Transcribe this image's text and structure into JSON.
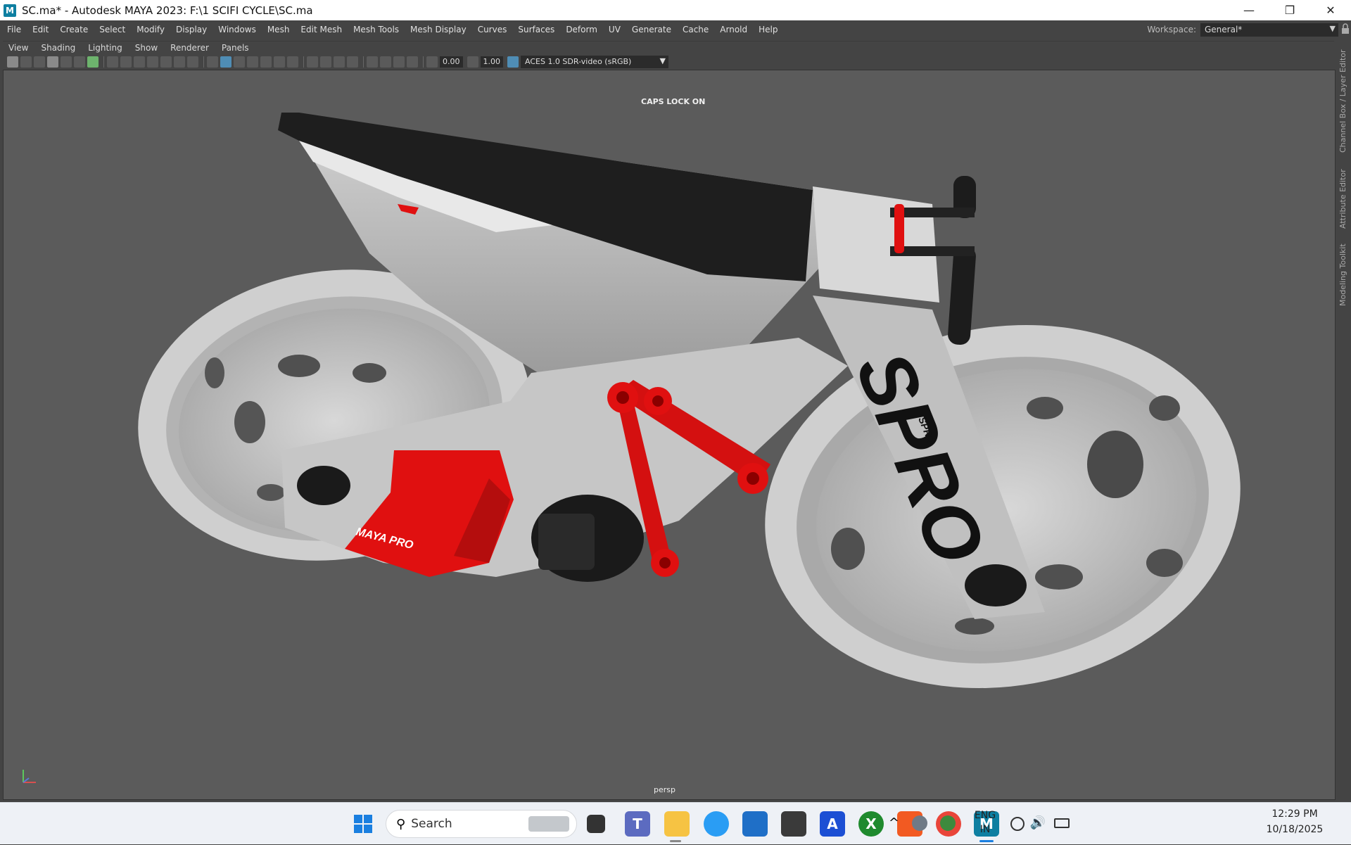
{
  "window": {
    "title": "SC.ma* - Autodesk MAYA 2023: F:\\1 SCIFI CYCLE\\SC.ma",
    "app_icon": "M",
    "minimize_icon": "—",
    "restore_icon": "❐",
    "close_icon": "✕"
  },
  "menubar": {
    "items": [
      "File",
      "Edit",
      "Create",
      "Select",
      "Modify",
      "Display",
      "Windows",
      "Mesh",
      "Edit Mesh",
      "Mesh Tools",
      "Mesh Display",
      "Curves",
      "Surfaces",
      "Deform",
      "UV",
      "Generate",
      "Cache",
      "Arnold",
      "Help"
    ]
  },
  "workspace": {
    "label": "Workspace:",
    "value": "General*"
  },
  "panel_menu": {
    "items": [
      "View",
      "Shading",
      "Lighting",
      "Show",
      "Renderer",
      "Panels"
    ]
  },
  "toolbar": {
    "field_a": "0.00",
    "field_b": "1.00",
    "color_space": "ACES 1.0 SDR-video (sRGB)"
  },
  "viewport": {
    "caps_lock": "CAPS LOCK ON",
    "camera": "persp",
    "decals": {
      "fork": "SPRO",
      "fork_small": "SPRO",
      "battery": "MAYA PRO"
    },
    "colors": {
      "background": "#5b5b5b",
      "frame": "#c4c4c4",
      "accent": "#e01010",
      "seat": "#1e1e1e"
    }
  },
  "sidebar": {
    "labels": [
      "Channel Box / Layer Editor",
      "Attribute Editor",
      "Modeling Toolkit"
    ]
  },
  "taskbar": {
    "search_placeholder": "Search",
    "apps": [
      "windows-start",
      "search",
      "task-view",
      "teams",
      "file-explorer",
      "edge",
      "store",
      "unity",
      "autodesk",
      "xbox",
      "brave",
      "chrome",
      "maya"
    ],
    "language_top": "ENG",
    "language_bottom": "IN",
    "time": "12:29 PM",
    "date": "10/18/2025"
  }
}
